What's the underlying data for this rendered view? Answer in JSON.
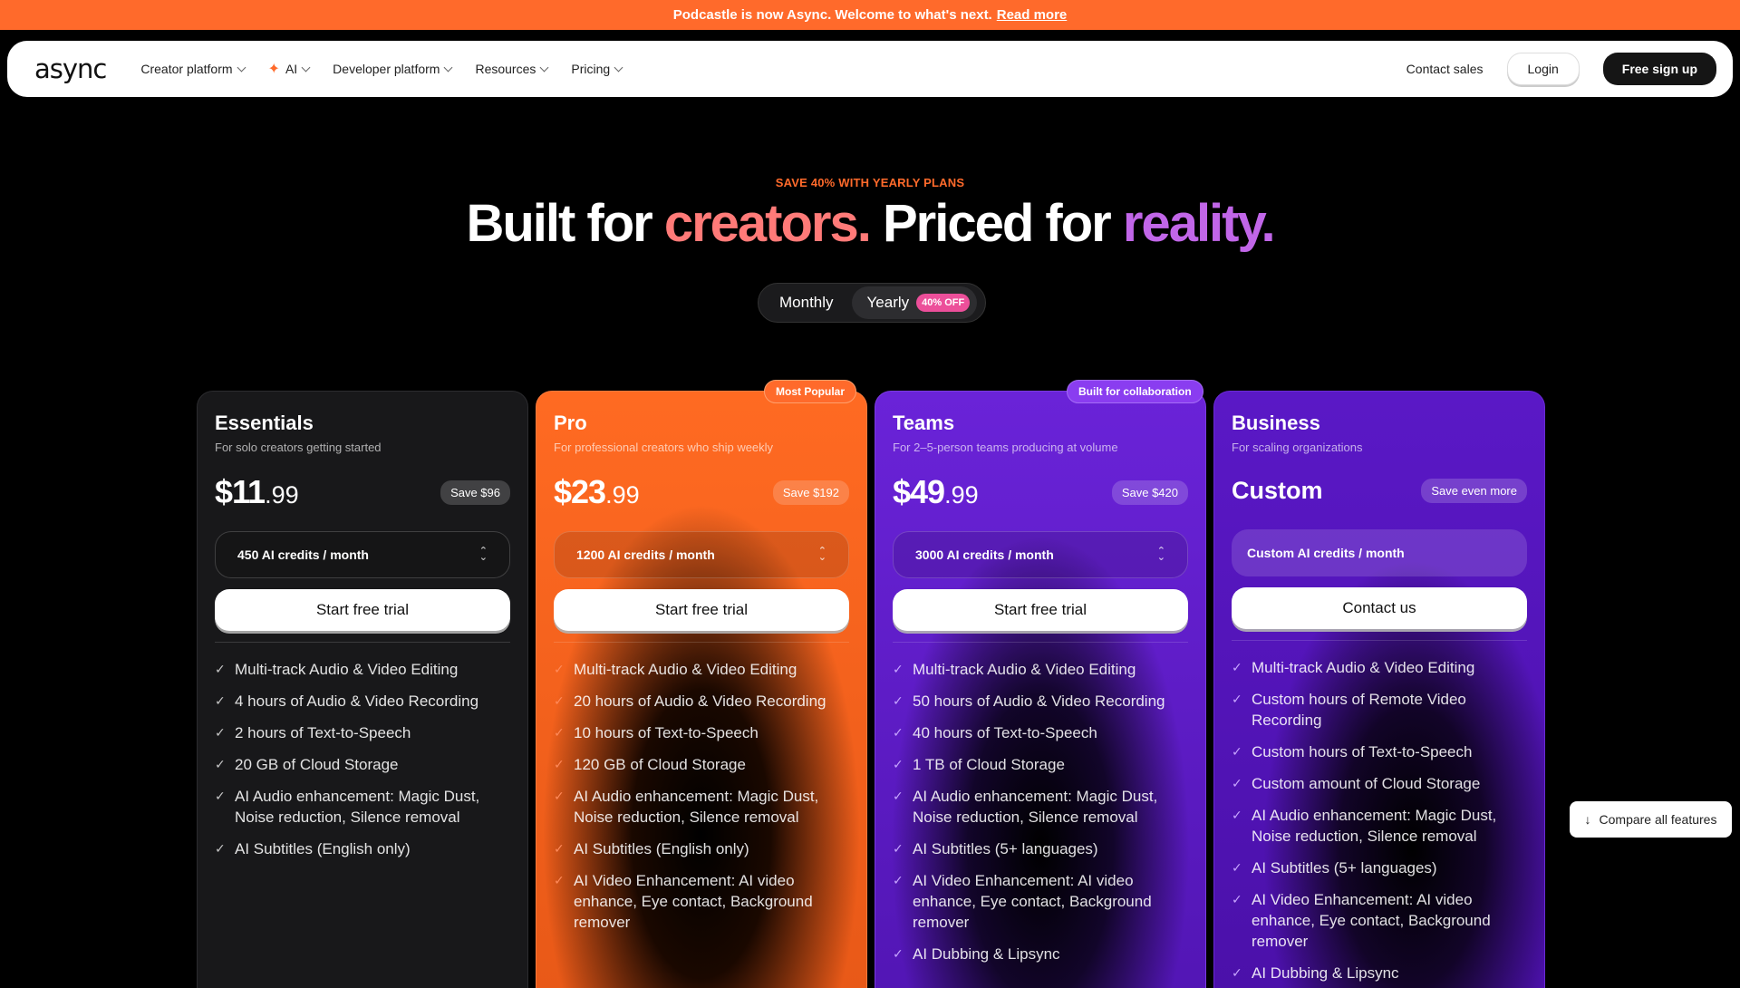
{
  "banner": {
    "text": "Podcastle is now Async. Welcome to what's next.",
    "link": "Read more"
  },
  "nav": {
    "logo": "async",
    "items": [
      {
        "label": "Creator platform"
      },
      {
        "label": "AI"
      },
      {
        "label": "Developer platform"
      },
      {
        "label": "Resources"
      },
      {
        "label": "Pricing"
      }
    ],
    "contact_sales": "Contact sales",
    "login": "Login",
    "signup": "Free sign up"
  },
  "hero": {
    "eyebrow": "SAVE 40% WITH YEARLY PLANS",
    "h_part1": "Built for ",
    "h_part2": "creators.",
    "h_part3": " Priced for ",
    "h_part4": "reality."
  },
  "toggle": {
    "monthly": "Monthly",
    "yearly": "Yearly",
    "discount": "40% OFF",
    "selected": "Yearly"
  },
  "badges": {
    "popular": "Most Popular",
    "collab": "Built for collaboration"
  },
  "plans": [
    {
      "name": "Essentials",
      "desc": "For solo creators getting started",
      "price_main": "$11",
      "price_cents": ".99",
      "save": "Save $96",
      "credits": "450 AI credits / month",
      "cta": "Start free trial",
      "features": [
        "Multi-track Audio & Video Editing",
        "4 hours of Audio & Video Recording",
        "2 hours of Text-to-Speech",
        "20 GB of Cloud Storage",
        "AI Audio enhancement: Magic Dust, Noise reduction, Silence removal",
        "AI Subtitles (English only)"
      ]
    },
    {
      "name": "Pro",
      "desc": "For professional creators who ship weekly",
      "price_main": "$23",
      "price_cents": ".99",
      "save": "Save $192",
      "credits": "1200 AI credits / month",
      "cta": "Start free trial",
      "features": [
        "Multi-track Audio & Video Editing",
        "20 hours of Audio & Video Recording",
        "10 hours of Text-to-Speech",
        "120 GB of Cloud Storage",
        "AI Audio enhancement: Magic Dust, Noise reduction, Silence removal",
        "AI Subtitles (English only)",
        "AI Video Enhancement: AI video enhance, Eye contact, Background remover"
      ]
    },
    {
      "name": "Teams",
      "desc": "For 2–5-person teams producing at volume",
      "price_main": "$49",
      "price_cents": ".99",
      "save": "Save $420",
      "credits": "3000 AI credits / month",
      "cta": "Start free trial",
      "features": [
        "Multi-track Audio & Video Editing",
        "50 hours of Audio & Video Recording",
        "40 hours of Text-to-Speech",
        "1 TB of Cloud Storage",
        "AI Audio enhancement: Magic Dust, Noise reduction, Silence removal",
        "AI Subtitles (5+ languages)",
        "AI Video Enhancement: AI video enhance, Eye contact, Background remover",
        "AI Dubbing & Lipsync"
      ]
    },
    {
      "name": "Business",
      "desc": "For scaling organizations",
      "price_main": "Custom",
      "save": "Save even more",
      "credits": "Custom AI credits / month",
      "cta": "Contact us",
      "features": [
        "Multi-track Audio & Video Editing",
        "Custom hours of Remote Video Recording",
        "Custom hours of Text-to-Speech",
        "Custom amount of Cloud Storage",
        "AI Audio enhancement: Magic Dust, Noise reduction, Silence removal",
        "AI Subtitles (5+ languages)",
        "AI Video Enhancement: AI video enhance, Eye contact, Background remover",
        "AI Dubbing & Lipsync"
      ]
    }
  ],
  "compare": "Compare all features",
  "colors": {
    "accent_orange": "#ff6a2b",
    "accent_purple": "#6a23d8",
    "accent_pink": "#ec4f9a"
  }
}
